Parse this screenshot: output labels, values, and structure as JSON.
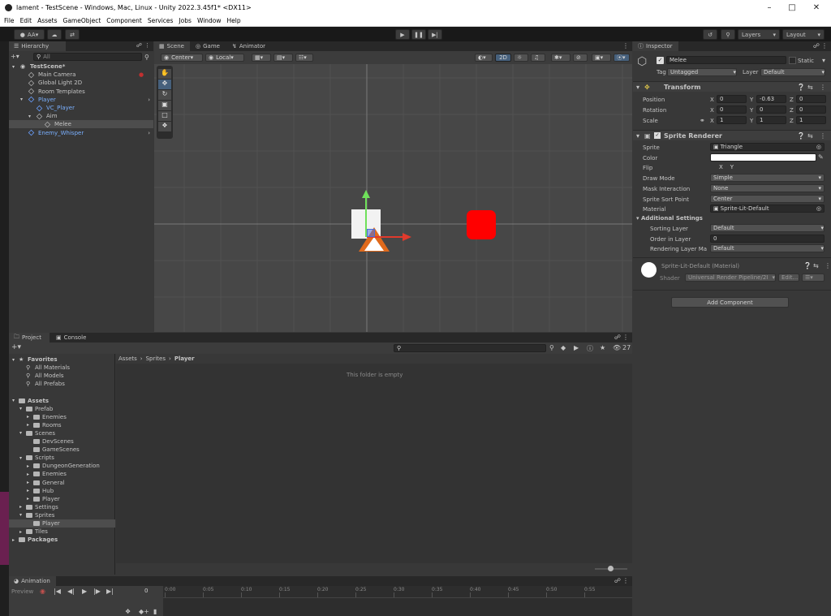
{
  "window": {
    "title": "lament - TestScene - Windows, Mac, Linux - Unity 2022.3.45f1* <DX11>"
  },
  "menu": [
    "File",
    "Edit",
    "Assets",
    "GameObject",
    "Component",
    "Services",
    "Jobs",
    "Window",
    "Help"
  ],
  "toolbar": {
    "account": "AA",
    "layers": "Layers",
    "layout": "Layout"
  },
  "hierarchy": {
    "tab": "Hierarchy",
    "search_placeholder": "All",
    "items": [
      {
        "label": "TestScene*",
        "depth": 0,
        "bold": true
      },
      {
        "label": "Main Camera",
        "depth": 1
      },
      {
        "label": "Global Light 2D",
        "depth": 1
      },
      {
        "label": "Room Templates",
        "depth": 1
      },
      {
        "label": "Player",
        "depth": 1,
        "blue": true
      },
      {
        "label": "VC_Player",
        "depth": 2,
        "blue": true
      },
      {
        "label": "Aim",
        "depth": 2
      },
      {
        "label": "Melee",
        "depth": 3,
        "selected": true
      },
      {
        "label": "Enemy_Whisper",
        "depth": 1,
        "blue": true
      }
    ]
  },
  "scene": {
    "tabs": [
      "Scene",
      "Game",
      "Animator"
    ],
    "pivot": "Center",
    "space": "Local",
    "mode_2d": "2D"
  },
  "inspector": {
    "tab": "Inspector",
    "object_name": "Melee",
    "static_label": "Static",
    "tag_label": "Tag",
    "tag_value": "Untagged",
    "layer_label": "Layer",
    "layer_value": "Default",
    "transform": {
      "title": "Transform",
      "position_label": "Position",
      "rotation_label": "Rotation",
      "scale_label": "Scale",
      "position": [
        "0",
        "-0.63",
        "0"
      ],
      "rotation": [
        "0",
        "0",
        "0"
      ],
      "scale": [
        "1",
        "1",
        "1"
      ]
    },
    "sprite_renderer": {
      "title": "Sprite Renderer",
      "rows": [
        {
          "label": "Sprite",
          "value": "Triangle"
        },
        {
          "label": "Color",
          "value": ""
        },
        {
          "label": "Flip",
          "value": "X    Y"
        },
        {
          "label": "Draw Mode",
          "value": "Simple"
        },
        {
          "label": "Mask Interaction",
          "value": "None"
        },
        {
          "label": "Sprite Sort Point",
          "value": "Center"
        },
        {
          "label": "Material",
          "value": "Sprite-Lit-Default"
        }
      ],
      "additional_settings": "Additional Settings",
      "sorting_layer_label": "Sorting Layer",
      "sorting_layer_value": "Default",
      "order_label": "Order in Layer",
      "order_value": "0",
      "rendering_layer_label": "Rendering Layer Ma",
      "rendering_layer_value": "Default"
    },
    "material": {
      "name": "Sprite-Lit-Default (Material)",
      "shader_label": "Shader",
      "shader_value": "Universal Render Pipeline/2I",
      "edit_label": "Edit..."
    },
    "add_component": "Add Component"
  },
  "project": {
    "tabs": [
      "Project",
      "Console"
    ],
    "count": "27",
    "breadcrumb": [
      "Assets",
      "Sprites",
      "Player"
    ],
    "empty_text": "This folder is empty",
    "tree": [
      {
        "label": "Favorites",
        "depth": 0,
        "bold": true
      },
      {
        "label": "All Materials",
        "depth": 1
      },
      {
        "label": "All Models",
        "depth": 1
      },
      {
        "label": "All Prefabs",
        "depth": 1
      },
      {
        "label": "",
        "depth": 0
      },
      {
        "label": "Assets",
        "depth": 0,
        "bold": true
      },
      {
        "label": "Prefab",
        "depth": 1
      },
      {
        "label": "Enemies",
        "depth": 2
      },
      {
        "label": "Rooms",
        "depth": 2
      },
      {
        "label": "Scenes",
        "depth": 1
      },
      {
        "label": "DevScenes",
        "depth": 2
      },
      {
        "label": "GameScenes",
        "depth": 2
      },
      {
        "label": "Scripts",
        "depth": 1
      },
      {
        "label": "DungeonGeneration",
        "depth": 2
      },
      {
        "label": "Enemies",
        "depth": 2
      },
      {
        "label": "General",
        "depth": 2
      },
      {
        "label": "Hub",
        "depth": 2
      },
      {
        "label": "Player",
        "depth": 2
      },
      {
        "label": "Settings",
        "depth": 1
      },
      {
        "label": "Sprites",
        "depth": 1
      },
      {
        "label": "Player",
        "depth": 2,
        "selected": true
      },
      {
        "label": "Tiles",
        "depth": 1
      },
      {
        "label": "Packages",
        "depth": 0,
        "bold": true
      }
    ]
  },
  "animation": {
    "tab": "Animation",
    "preview_label": "Preview",
    "frame": "0",
    "ticks": [
      "0:00",
      "0:05",
      "0:10",
      "0:15",
      "0:20",
      "0:25",
      "0:30",
      "0:35",
      "0:40",
      "0:45",
      "0:50",
      "0:55"
    ]
  }
}
